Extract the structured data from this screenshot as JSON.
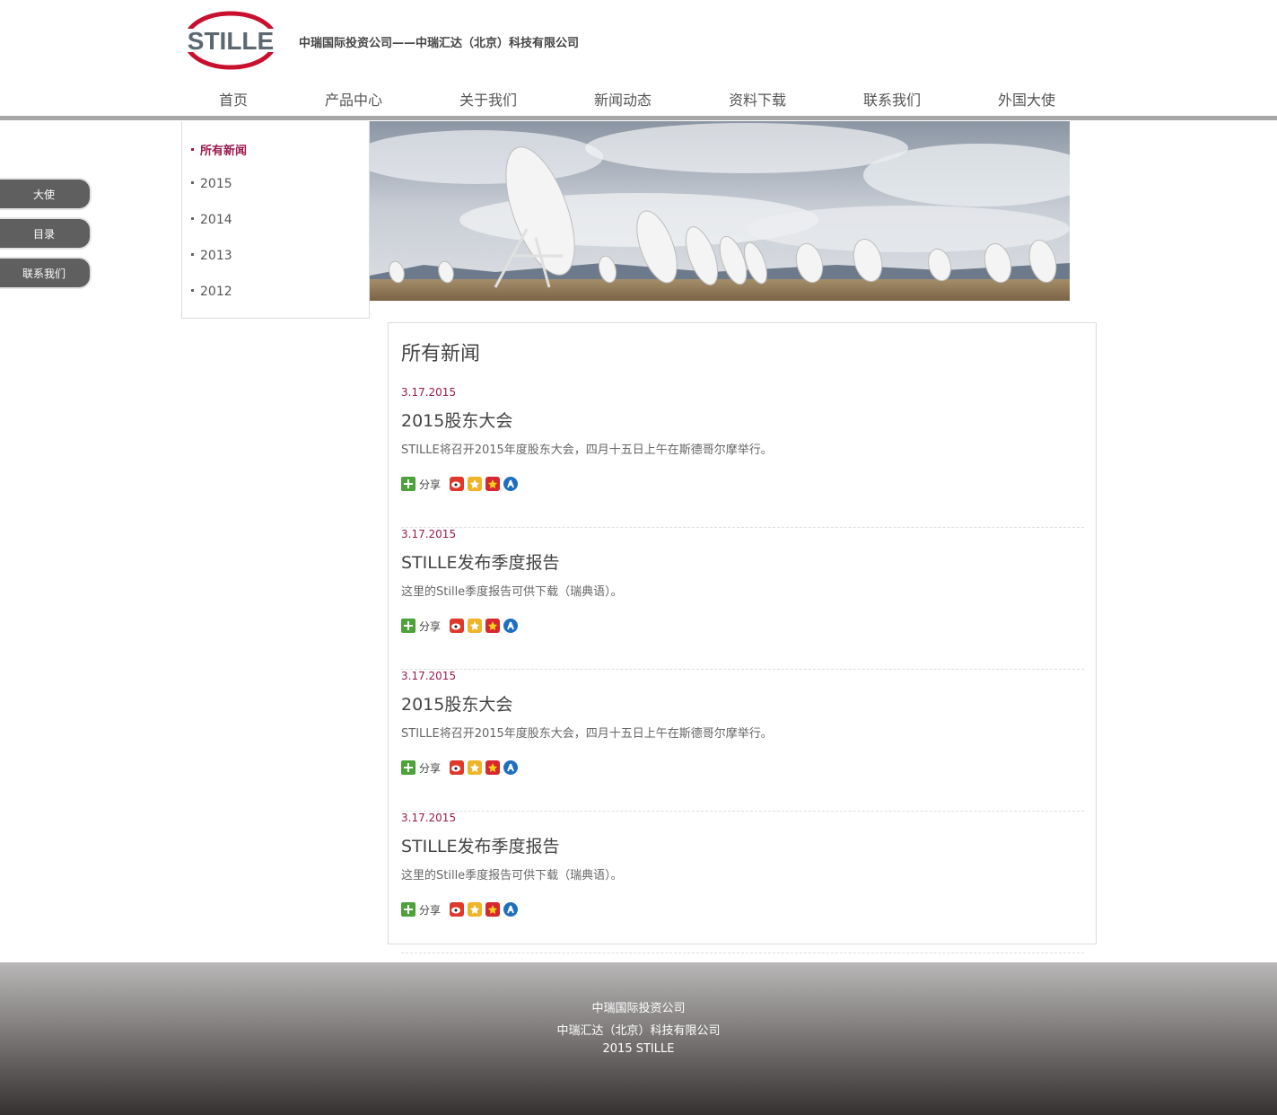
{
  "header": {
    "logo_text": "STILLE",
    "company_line": "中瑞国际投资公司——中瑞汇达（北京）科技有限公司"
  },
  "nav": [
    {
      "label": "首页"
    },
    {
      "label": "产品中心"
    },
    {
      "label": "关于我们"
    },
    {
      "label": "新闻动态"
    },
    {
      "label": "资料下载"
    },
    {
      "label": "联系我们"
    },
    {
      "label": "外国大使"
    }
  ],
  "side_buttons": [
    {
      "label": "大使"
    },
    {
      "label": "目录"
    },
    {
      "label": "联系我们"
    }
  ],
  "categories": [
    {
      "label": "所有新闻",
      "active": true
    },
    {
      "label": "2015"
    },
    {
      "label": "2014"
    },
    {
      "label": "2013"
    },
    {
      "label": "2012"
    }
  ],
  "news": {
    "title": "所有新闻",
    "share_label": "分享",
    "items": [
      {
        "date": "3.17.2015",
        "heading": "2015股东大会",
        "summary": "STILLE将召开2015年度股东大会，四月十五日上午在斯德哥尔摩举行。"
      },
      {
        "date": "3.17.2015",
        "heading": "STILLE发布季度报告",
        "summary": "这里的Stille季度报告可供下载（瑞典语）。"
      },
      {
        "date": "3.17.2015",
        "heading": "2015股东大会",
        "summary": "STILLE将召开2015年度股东大会，四月十五日上午在斯德哥尔摩举行。"
      },
      {
        "date": "3.17.2015",
        "heading": "STILLE发布季度报告",
        "summary": "这里的Stille季度报告可供下载（瑞典语）。"
      }
    ]
  },
  "footer": {
    "line1": "中瑞国际投资公司",
    "line2": "中瑞汇达（北京）科技有限公司",
    "line3": "2015 STILLE"
  },
  "colors": {
    "accent": "#9b1b4b",
    "logo_red": "#c8102e",
    "logo_gray": "#5d6770",
    "nav_bar": "#a7a7a7",
    "side_button": "#5f5f5f"
  }
}
